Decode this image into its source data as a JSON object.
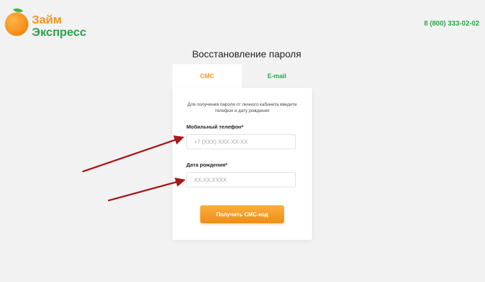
{
  "brand": {
    "line1": "Займ",
    "line2": "Экспресс"
  },
  "header": {
    "phone": "8 (800) 333-02-02"
  },
  "page": {
    "title": "Восстановление пароля"
  },
  "tabs": [
    {
      "label": "СМС",
      "active": true
    },
    {
      "label": "E-mail",
      "active": false
    }
  ],
  "form": {
    "hint": "Для получения пароля от личного кабинета введите телефон и дату рождения",
    "phone_label": "Мобильный телефон*",
    "phone_placeholder": "+7 (XXX) XXX-XX-XX",
    "birthdate_label": "Дата рождения*",
    "birthdate_placeholder": "XX.XX.XXXX",
    "submit_label": "Получить СМС-код"
  },
  "colors": {
    "orange": "#f7941d",
    "green": "#2aa548",
    "arrow": "#a8171a"
  }
}
